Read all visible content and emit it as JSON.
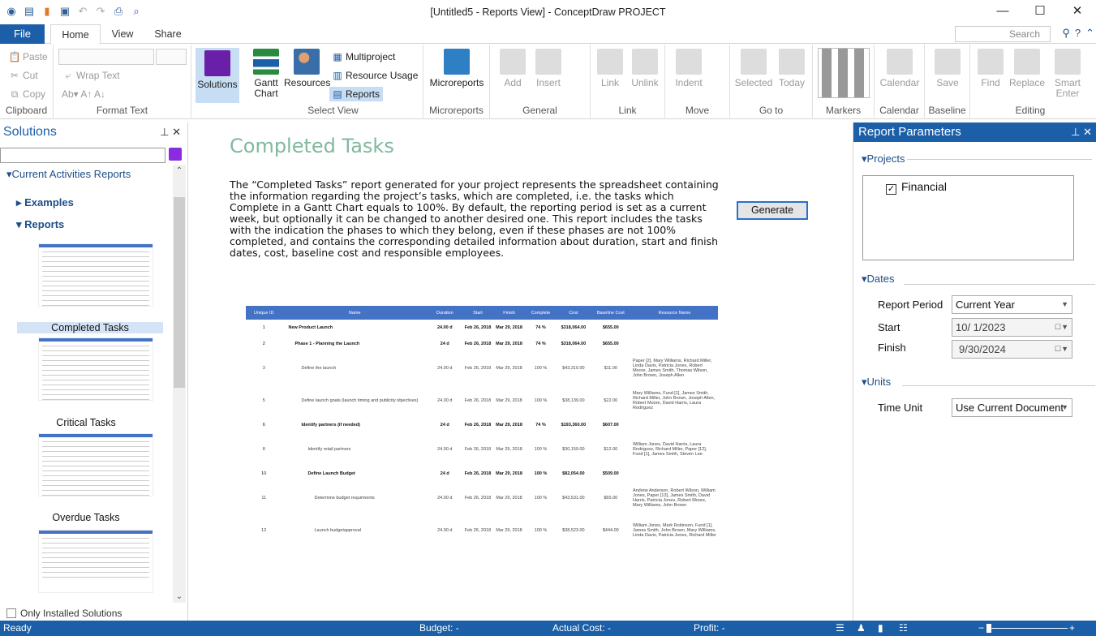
{
  "window": {
    "title": "[Untitled5 - Reports View] - ConceptDraw PROJECT"
  },
  "menu": {
    "file": "File",
    "tabs": [
      "Home",
      "View",
      "Share"
    ],
    "search_placeholder": "Search"
  },
  "ribbon": {
    "clipboard": {
      "paste": "Paste",
      "cut": "Cut",
      "copy": "Copy",
      "label": "Clipboard"
    },
    "format_text": {
      "wrap": "Wrap Text",
      "label": "Format Text"
    },
    "solutions": "Solutions",
    "select_view": {
      "gantt": "Gantt Chart",
      "resources": "Resources",
      "multiproject": "Multiproject",
      "resource_usage": "Resource Usage",
      "reports": "Reports",
      "label": "Select View"
    },
    "microreports": {
      "btn": "Microreports",
      "label": "Microreports"
    },
    "general": {
      "add": "Add",
      "insert": "Insert",
      "label": "General"
    },
    "link": {
      "link": "Link",
      "unlink": "Unlink",
      "label": "Link"
    },
    "move": {
      "indent": "Indent",
      "label": "Move"
    },
    "goto": {
      "selected": "Selected",
      "today": "Today",
      "label": "Go to"
    },
    "markers": {
      "label": "Markers"
    },
    "calendar": {
      "btn": "Calendar",
      "label": "Calendar"
    },
    "baseline": {
      "btn": "Save",
      "label": "Baseline"
    },
    "editing": {
      "find": "Find",
      "replace": "Replace",
      "smart": "Smart Enter",
      "label": "Editing"
    }
  },
  "solutions_pane": {
    "title": "Solutions",
    "tree": {
      "root": "Current Activities Reports",
      "examples": "Examples",
      "reports": "Reports"
    },
    "reports": [
      "Completed Tasks",
      "Critical Tasks",
      "Overdue Tasks"
    ],
    "only_installed": "Only Installed Solutions"
  },
  "report": {
    "title": "Completed Tasks",
    "description": "The “Completed Tasks” report generated for your project represents the spreadsheet containing the information regarding the project’s tasks, which are completed, i.e. the tasks which Complete in a Gantt Chart equals to 100%. By default, the reporting period is set as a current week, but optionally it can be changed to another desired one. This report includes the tasks with the indication the phases to which they belong, even if these phases are not 100% completed, and contains the corresponding detailed information about duration, start and finish dates, cost, baseline cost and responsible employees.",
    "generate": "Generate",
    "columns": [
      "Unique ID",
      "Name",
      "Duration",
      "Start",
      "Finish",
      "Complete",
      "Cost",
      "Baseline Cost",
      "Resource Name"
    ],
    "rows": [
      {
        "id": "1",
        "name": "New Product Launch",
        "dur": "24.00 d",
        "start": "Feb 26, 2018",
        "finish": "Mar 29, 2018",
        "comp": "74 %",
        "cost": "$318,064.00",
        "base": "$655.00",
        "res": "",
        "bold": true,
        "indent": 0
      },
      {
        "id": "2",
        "name": "Phase 1 - Planning the Launch",
        "dur": "24 d",
        "start": "Feb 26, 2018",
        "finish": "Mar 29, 2018",
        "comp": "74 %",
        "cost": "$318,064.00",
        "base": "$655.00",
        "res": "",
        "bold": true,
        "indent": 1
      },
      {
        "id": "3",
        "name": "Define the launch",
        "dur": "24.00 d",
        "start": "Feb 26, 2018",
        "finish": "Mar 29, 2018",
        "comp": "100 %",
        "cost": "$43,310.00",
        "base": "$11.00",
        "res": "Paper [2], Mary Williams, Richard Miller, Linda Davis, Patricia Jones, Robert Moore, James Smith, Thomas Wilson, John Brown, Joseph Allen",
        "bold": false,
        "indent": 2
      },
      {
        "id": "5",
        "name": "Define launch goals (launch timing and publicity objectives)",
        "dur": "24.00 d",
        "start": "Feb 26, 2018",
        "finish": "Mar 29, 2018",
        "comp": "100 %",
        "cost": "$38,139.00",
        "base": "$22.00",
        "res": "Mary Williams, Fund [1], James Smith, Richard Miller, John Brown, Joseph Allen, Robert Moore, David Harris, Laura Rodriguez",
        "bold": false,
        "indent": 2
      },
      {
        "id": "6",
        "name": "Identify partners (if needed)",
        "dur": "24 d",
        "start": "Feb 26, 2018",
        "finish": "Mar 29, 2018",
        "comp": "74 %",
        "cost": "$193,360.00",
        "base": "$607.00",
        "res": "",
        "bold": true,
        "indent": 2
      },
      {
        "id": "8",
        "name": "Identify retail partners",
        "dur": "24.00 d",
        "start": "Feb 26, 2018",
        "finish": "Mar 29, 2018",
        "comp": "100 %",
        "cost": "$30,159.00",
        "base": "$12.00",
        "res": "William Jones, David Harris, Laura Rodriguez, Richard Miller, Paper [12], Fund [1], James Smith, Steven Lee",
        "bold": false,
        "indent": 3
      },
      {
        "id": "10",
        "name": "Define Launch Budget",
        "dur": "24 d",
        "start": "Feb 26, 2018",
        "finish": "Mar 29, 2018",
        "comp": "100 %",
        "cost": "$82,054.00",
        "base": "$509.00",
        "res": "",
        "bold": true,
        "indent": 3
      },
      {
        "id": "11",
        "name": "Determine budget requirments",
        "dur": "24.00 d",
        "start": "Feb 26, 2018",
        "finish": "Mar 29, 2018",
        "comp": "100 %",
        "cost": "$43,531.00",
        "base": "$65.00",
        "res": "Andrew Anderson, Robert Wilson, William Jones, Paper [13], James Smith, David Harris, Patricia Jones, Robert Moore, Mary Williams, John Brown",
        "bold": false,
        "indent": 4
      },
      {
        "id": "12",
        "name": "Launch budgetapproval",
        "dur": "24.00 d",
        "start": "Feb 26, 2018",
        "finish": "Mar 29, 2018",
        "comp": "100 %",
        "cost": "$38,523.00",
        "base": "$444.00",
        "res": "William Jones, Mark Robinson, Fund [1], James Smith, John Brown, Mary Williams, Linda Davis, Patricia Jones, Richard Miller",
        "bold": false,
        "indent": 4
      }
    ]
  },
  "params": {
    "title": "Report Parameters",
    "projects_label": "Projects",
    "project": "Financial",
    "dates_label": "Dates",
    "report_period_label": "Report Period",
    "report_period": "Current Year",
    "start_label": "Start",
    "start": "10/  1/2023",
    "finish_label": "Finish",
    "finish": "9/30/2024",
    "units_label": "Units",
    "time_unit_label": "Time Unit",
    "time_unit": "Use Current Document"
  },
  "status": {
    "ready": "Ready",
    "budget": "Budget: -",
    "actual_cost": "Actual Cost: -",
    "profit": "Profit: -"
  }
}
